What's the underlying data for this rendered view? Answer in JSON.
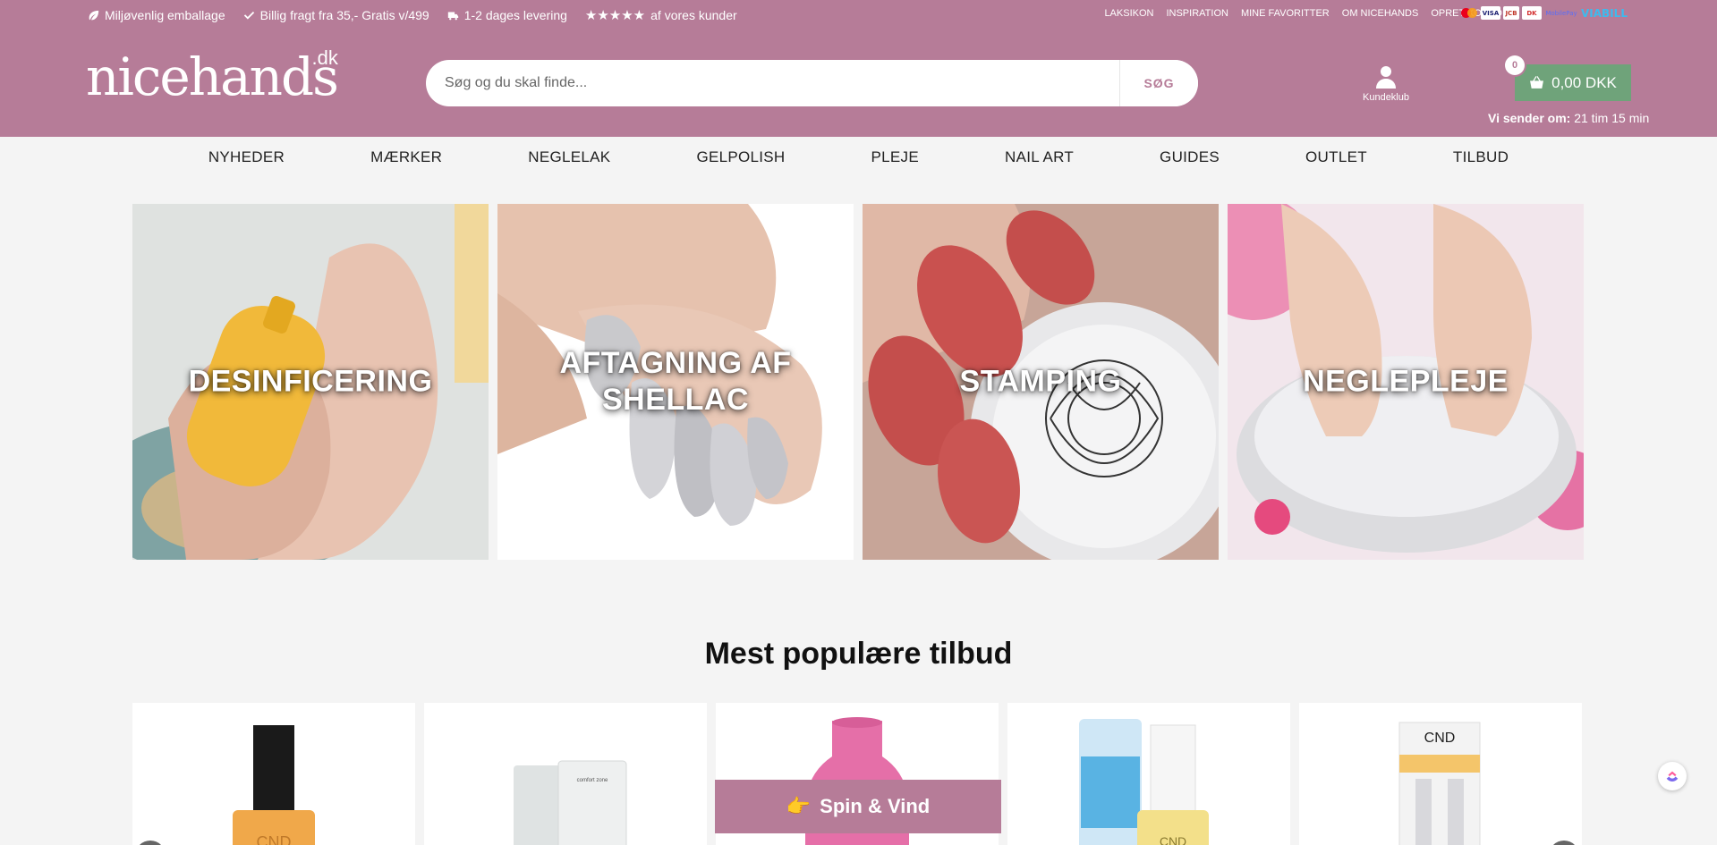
{
  "topbar": {
    "usps": [
      {
        "icon": "leaf-icon",
        "text": "Miljøvenlig emballage"
      },
      {
        "icon": "check-icon",
        "text": "Billig fragt fra 35,- Gratis v/499"
      },
      {
        "icon": "truck-icon",
        "text": "1-2 dages levering"
      }
    ],
    "rating_text": "af vores kunder",
    "rating_stars": 5,
    "links": [
      "LAKSIKON",
      "INSPIRATION",
      "MINE FAVORITTER",
      "OM NICEHANDS",
      "OPRET KONTO"
    ],
    "payment_icons": [
      "mastercard-icon",
      "visa-icon",
      "jcb-icon",
      "dankort-icon",
      "mobilepay-icon",
      "viabill-icon"
    ],
    "payment_labels": {
      "visa": "VISA",
      "jcb": "JCB",
      "dankort": "DK",
      "mobilepay": "MobilePay",
      "viabill": "VIABILL"
    }
  },
  "header": {
    "logo_text": "nicehands",
    "logo_suffix": ".dk",
    "search_placeholder": "Søg og du skal finde...",
    "search_button": "SØG",
    "kundeklub_label": "Kundeklub",
    "cart_count": "0",
    "cart_total": "0,00 DKK",
    "shipping_label": "Vi sender om:",
    "shipping_time": "21 tim 15 min",
    "brand_color": "#b67c98",
    "cart_color": "#6fa37a"
  },
  "nav": [
    "NYHEDER",
    "MÆRKER",
    "NEGLELAK",
    "GELPOLISH",
    "PLEJE",
    "NAIL ART",
    "GUIDES",
    "OUTLET",
    "TILBUD"
  ],
  "categories": [
    {
      "label": "DESINFICERING"
    },
    {
      "label": "AFTAGNING AF SHELLAC"
    },
    {
      "label": "STAMPING"
    },
    {
      "label": "NEGLEPLEJE"
    }
  ],
  "section_title": "Mest populære tilbud",
  "products": [
    {
      "brand_label": "CND"
    },
    {
      "brand_label": "comfort zone"
    },
    {
      "brand_label": ""
    },
    {
      "brand_label": "CND"
    },
    {
      "brand_label": "CND"
    }
  ],
  "spin_button": {
    "emoji": "👉",
    "label": "Spin & Vind"
  }
}
